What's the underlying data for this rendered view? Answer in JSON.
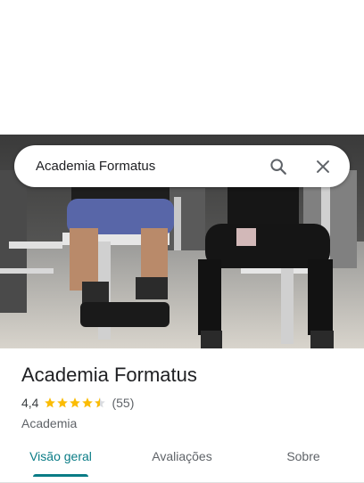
{
  "search": {
    "query": "Academia Formatus",
    "search_icon": "search-icon",
    "close_icon": "close-icon"
  },
  "hero": {
    "image": "gym-photo"
  },
  "place": {
    "name": "Academia Formatus",
    "rating": "4,4",
    "stars": 4.5,
    "review_count": "(55)",
    "category": "Academia"
  },
  "tabs": [
    {
      "label": "Visão geral",
      "active": true
    },
    {
      "label": "Avaliações",
      "active": false
    },
    {
      "label": "Sobre",
      "active": false
    }
  ],
  "colors": {
    "accent": "#0a7c86",
    "star": "#fbbc04",
    "text": "#202124",
    "muted": "#5f6368"
  }
}
